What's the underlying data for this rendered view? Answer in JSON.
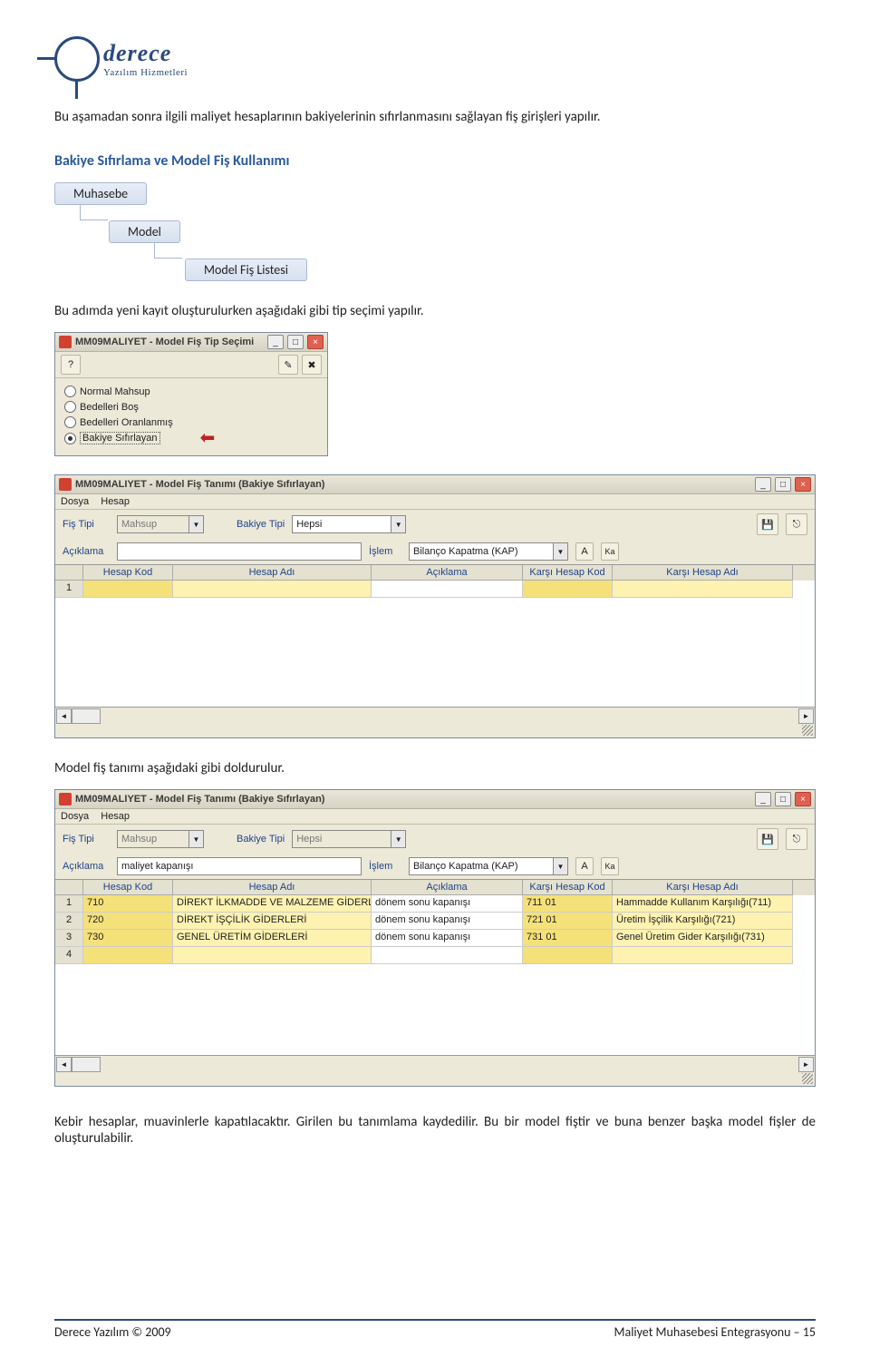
{
  "logo": {
    "name": "derece",
    "sub": "Yazılım Hizmetleri"
  },
  "p1": "Bu aşamadan sonra ilgili maliyet hesaplarının bakiyelerinin sıfırlanmasını sağlayan fiş girişleri yapılır.",
  "h2": "Bakiye Sıfırlama ve Model Fiş Kullanımı",
  "bc": {
    "a": "Muhasebe",
    "b": "Model",
    "c": "Model Fiş Listesi"
  },
  "p2": "Bu adımda yeni kayıt oluşturulurken aşağıdaki gibi tip seçimi yapılır.",
  "dlg1": {
    "title": "MM09MALIYET - Model Fiş Tip Seçimi",
    "opts": [
      "Normal Mahsup",
      "Bedelleri Boş",
      "Bedelleri Oranlanmış",
      "Bakiye Sıfırlayan"
    ]
  },
  "dlg2": {
    "title": "MM09MALIYET - Model Fiş Tanımı (Bakiye Sıfırlayan)",
    "menu": {
      "a": "Dosya",
      "b": "Hesap"
    },
    "lbl": {
      "fistipi": "Fiş Tipi",
      "bakiye": "Bakiye Tipi",
      "aciklama": "Açıklama",
      "islem": "İşlem"
    },
    "val": {
      "fistipi": "Mahsup",
      "bakiye": "Hepsi",
      "aciklama": "",
      "islem": "Bilanço Kapatma (KAP)"
    },
    "cols": {
      "hk": "Hesap Kod",
      "ha": "Hesap Adı",
      "ak": "Açıklama",
      "kk": "Karşı Hesap Kod",
      "ka": "Karşı Hesap Adı"
    }
  },
  "p3": "Model fiş tanımı aşağıdaki gibi doldurulur.",
  "dlg3": {
    "title": "MM09MALIYET - Model Fiş Tanımı (Bakiye Sıfırlayan)",
    "menu": {
      "a": "Dosya",
      "b": "Hesap"
    },
    "lbl": {
      "fistipi": "Fiş Tipi",
      "bakiye": "Bakiye Tipi",
      "aciklama": "Açıklama",
      "islem": "İşlem"
    },
    "val": {
      "fistipi": "Mahsup",
      "bakiye": "Hepsi",
      "aciklama": "maliyet kapanışı",
      "islem": "Bilanço Kapatma (KAP)"
    },
    "cols": {
      "hk": "Hesap Kod",
      "ha": "Hesap Adı",
      "ak": "Açıklama",
      "kk": "Karşı Hesap Kod",
      "ka": "Karşı Hesap Adı"
    },
    "rows": [
      {
        "n": "1",
        "hk": "710",
        "ha": "DİREKT İLKMADDE VE MALZEME GİDERLER",
        "ak": "dönem sonu kapanışı",
        "kk": "711 01",
        "ka": "Hammadde Kullanım Karşılığı(711)"
      },
      {
        "n": "2",
        "hk": "720",
        "ha": "DİREKT İŞÇİLİK GİDERLERİ",
        "ak": "dönem sonu kapanışı",
        "kk": "721 01",
        "ka": "Üretim İşçilik Karşılığı(721)"
      },
      {
        "n": "3",
        "hk": "730",
        "ha": "GENEL ÜRETİM GİDERLERİ",
        "ak": "dönem sonu kapanışı",
        "kk": "731 01",
        "ka": "Genel Üretim Gider Karşılığı(731)"
      },
      {
        "n": "4",
        "hk": "",
        "ha": "",
        "ak": "",
        "kk": "",
        "ka": ""
      }
    ]
  },
  "p4": "Kebir hesaplar, muavinlerle kapatılacaktır. Girilen bu tanımlama kaydedilir. Bu bir model fiştir ve buna benzer başka model fişler de oluşturulabilir.",
  "footer": {
    "left": "Derece Yazılım © 2009",
    "right": "Maliyet Muhasebesi Entegrasyonu – 15"
  }
}
